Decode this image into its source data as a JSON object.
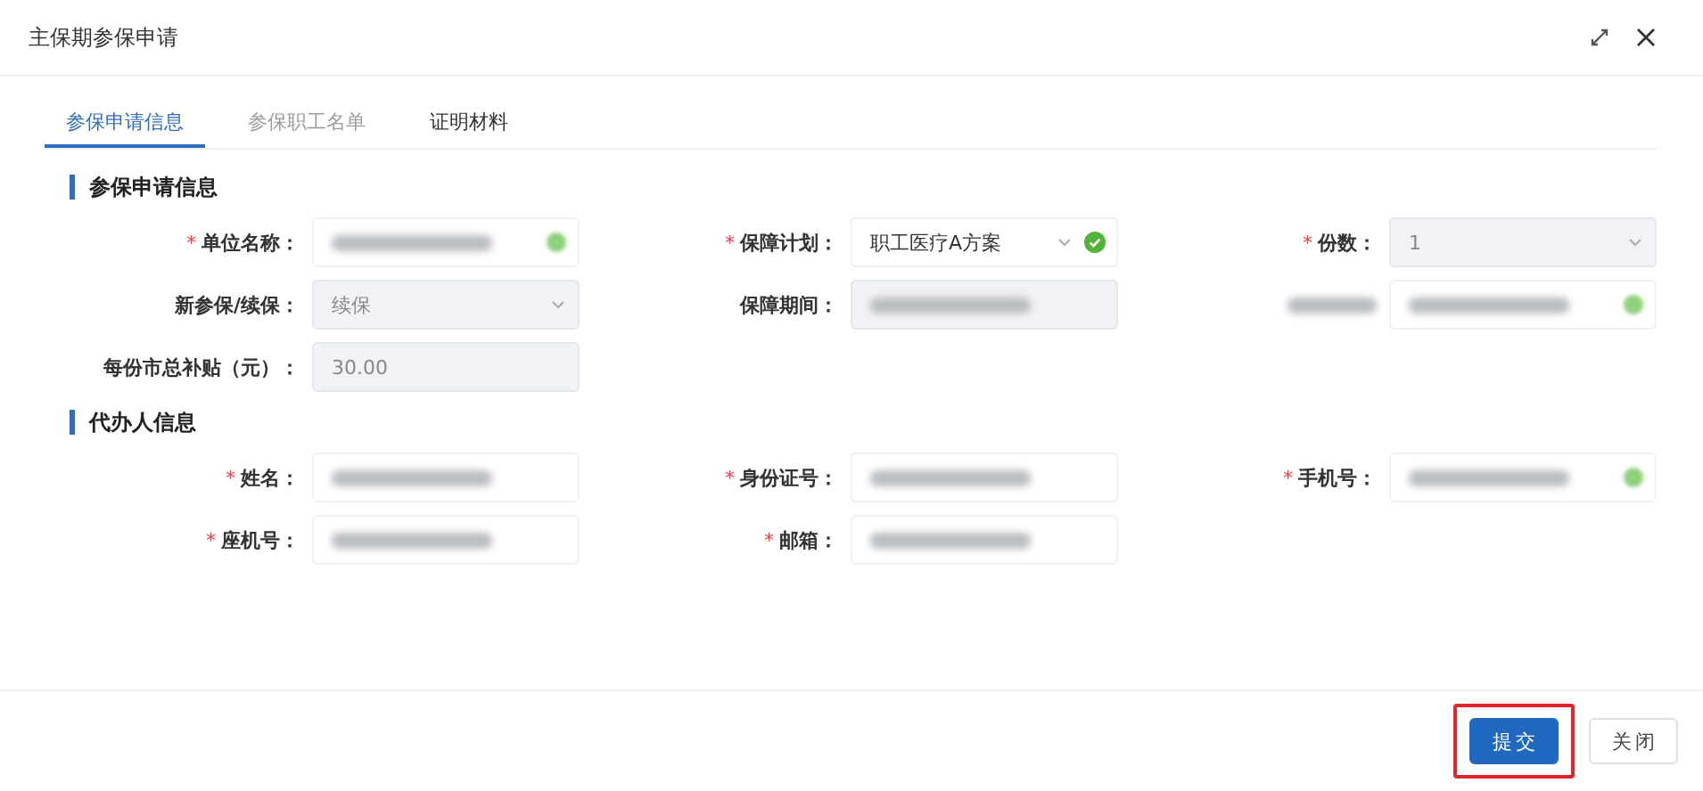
{
  "dialog": {
    "title": "主保期参保申请"
  },
  "tabs": [
    {
      "label": "参保申请信息",
      "selected": true,
      "disabled": false
    },
    {
      "label": "参保职工名单",
      "selected": false,
      "disabled": true
    },
    {
      "label": "证明材料",
      "selected": false,
      "disabled": false
    }
  ],
  "sections": [
    {
      "title": "参保申请信息",
      "fields": [
        {
          "asterisk": "*",
          "label": "单位名称：",
          "kind": "input",
          "redacted": true,
          "disabled": false,
          "valid": true
        },
        {
          "asterisk": "*",
          "label": "保障计划：",
          "kind": "select",
          "value": "职工医疗A方案",
          "disabled": false,
          "valid": true
        },
        {
          "asterisk": "*",
          "label": "份数：",
          "kind": "select",
          "value": "1",
          "disabled": true
        },
        {
          "label": "新参保/续保：",
          "kind": "select",
          "value": "续保",
          "disabled": true
        },
        {
          "label": "保障期间：",
          "kind": "input",
          "redacted": true,
          "disabled": true
        },
        {
          "label_redacted": true,
          "kind": "input",
          "redacted": true,
          "disabled": false,
          "valid": true
        },
        {
          "label": "每份市总补贴（元）：",
          "kind": "input",
          "value": "30.00",
          "disabled": true
        }
      ]
    },
    {
      "title": "代办人信息",
      "fields": [
        {
          "asterisk": "*",
          "label": "姓名：",
          "kind": "input",
          "redacted": true,
          "disabled": false
        },
        {
          "asterisk": "*",
          "label": "身份证号：",
          "kind": "input",
          "redacted": true,
          "disabled": false
        },
        {
          "asterisk": "*",
          "label": "手机号：",
          "kind": "input",
          "redacted": true,
          "disabled": false,
          "valid": true
        },
        {
          "asterisk": "*",
          "label": "座机号：",
          "kind": "input",
          "redacted": true,
          "disabled": false
        },
        {
          "asterisk": "*",
          "label": "邮箱：",
          "kind": "input",
          "redacted": true,
          "disabled": false
        }
      ]
    }
  ],
  "buttons": [
    {
      "label": "提交",
      "kind": "primary",
      "highlighted": true
    },
    {
      "label": "关闭",
      "kind": "default"
    }
  ]
}
